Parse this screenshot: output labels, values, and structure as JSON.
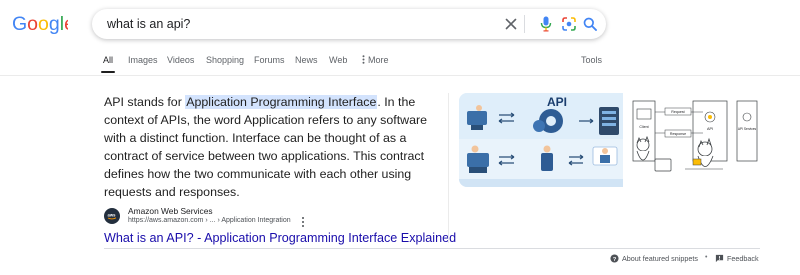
{
  "search": {
    "query": "what is an api?"
  },
  "tabs": [
    "All",
    "Images",
    "Videos",
    "Shopping",
    "Forums",
    "News",
    "Web",
    "More"
  ],
  "tools_label": "Tools",
  "snippet": {
    "pre": "API stands for ",
    "highlight": "Application Programming Interface",
    "post": ". In the context of APIs, the word Application refers to any software with a distinct function. Interface can be thought of as a contract of service between two applications. This contract defines how the two communicate with each other using requests and responses."
  },
  "source": {
    "site_name": "Amazon Web Services",
    "url": "https://aws.amazon.com › ... › Application Integration",
    "title": "What is an API? - Application Programming Interface Explained"
  },
  "image_panel": {
    "left_title": "API",
    "right_labels": [
      "Client",
      "Request",
      "Response",
      "API",
      "API Services"
    ]
  },
  "footer": {
    "about": "About featured snippets",
    "separator": "•",
    "feedback": "Feedback"
  },
  "colors": {
    "link": "#1a0dab",
    "highlight": "#d3e3fd",
    "google_blue": "#4285f4",
    "google_red": "#ea4335",
    "google_yellow": "#fbbc05",
    "google_green": "#34a853"
  }
}
